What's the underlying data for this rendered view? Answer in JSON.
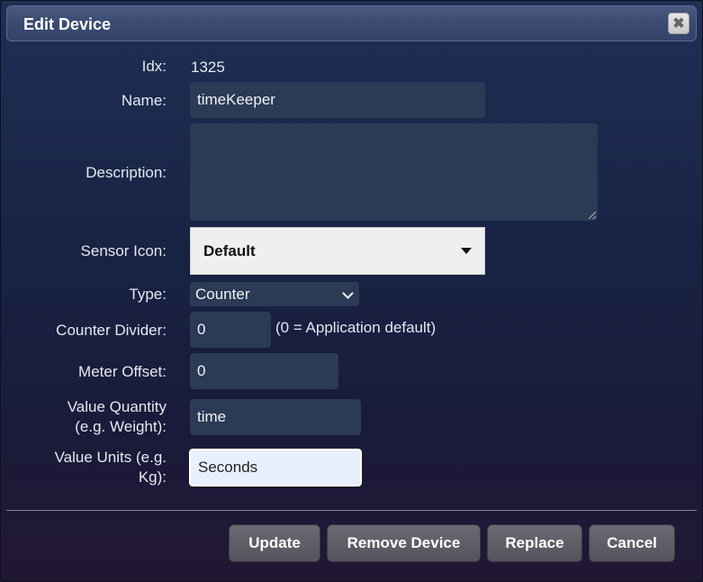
{
  "dialog": {
    "title": "Edit Device",
    "close_icon": "close-icon"
  },
  "form": {
    "idx_label": "Idx:",
    "idx_value": "1325",
    "name_label": "Name:",
    "name_value": "timeKeeper",
    "description_label": "Description:",
    "description_value": "",
    "sensor_icon_label": "Sensor Icon:",
    "sensor_icon_value": "Default",
    "type_label": "Type:",
    "type_value": "Counter",
    "counter_divider_label": "Counter Divider:",
    "counter_divider_value": "0",
    "counter_divider_hint": "(0 = Application default)",
    "meter_offset_label": "Meter Offset:",
    "meter_offset_value": "0",
    "value_quantity_label_1": "Value Quantity",
    "value_quantity_label_2": "(e.g. Weight):",
    "value_quantity_value": "time",
    "value_units_label_1": "Value Units (e.g.",
    "value_units_label_2": "Kg):",
    "value_units_value": "Seconds"
  },
  "buttons": {
    "update": "Update",
    "remove_device": "Remove Device",
    "replace": "Replace",
    "cancel": "Cancel"
  }
}
